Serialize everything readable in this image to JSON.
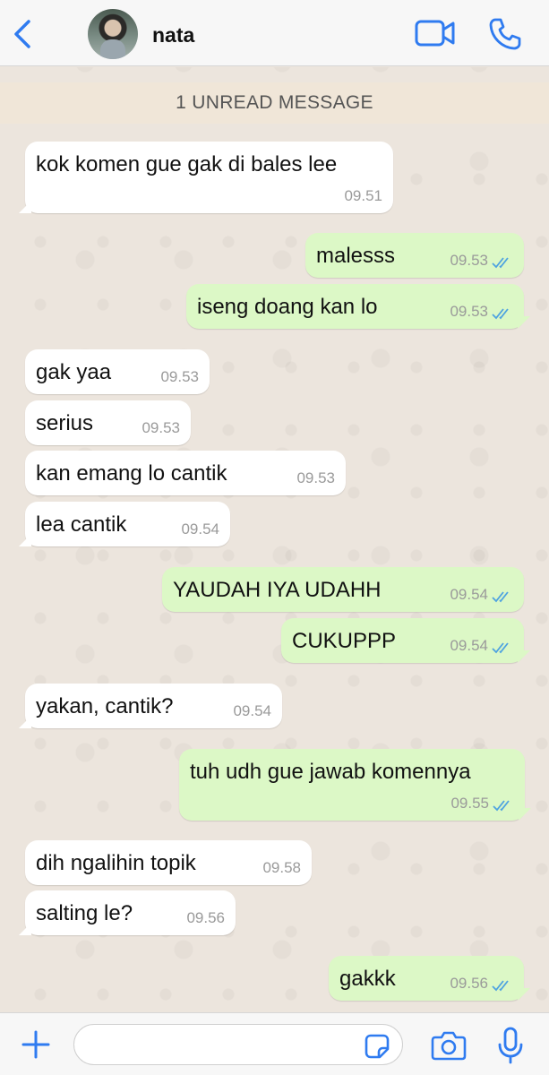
{
  "header": {
    "contact_name": "nata",
    "back_icon": "chevron-left-icon",
    "video_icon": "video-call-icon",
    "call_icon": "phone-icon",
    "accent_color": "#2f7bf0"
  },
  "chat": {
    "unread_banner": "1 UNREAD MESSAGE",
    "messages": [
      {
        "dir": "in",
        "text": "kok komen gue gak di bales lee",
        "time": "09.51"
      },
      {
        "dir": "out",
        "text": "malesss",
        "time": "09.53",
        "status": "read"
      },
      {
        "dir": "out",
        "text": "iseng doang kan lo",
        "time": "09.53",
        "status": "read"
      },
      {
        "dir": "in",
        "text": "gak yaa",
        "time": "09.53"
      },
      {
        "dir": "in",
        "text": "serius",
        "time": "09.53"
      },
      {
        "dir": "in",
        "text": "kan emang lo cantik",
        "time": "09.53"
      },
      {
        "dir": "in",
        "text": "lea cantik",
        "time": "09.54"
      },
      {
        "dir": "out",
        "text": "YAUDAH IYA UDAHH",
        "time": "09.54",
        "status": "read"
      },
      {
        "dir": "out",
        "text": "CUKUPPP",
        "time": "09.54",
        "status": "read"
      },
      {
        "dir": "in",
        "text": "yakan, cantik?",
        "time": "09.54"
      },
      {
        "dir": "out",
        "text": "tuh udh gue jawab komennya",
        "time": "09.55",
        "status": "read"
      },
      {
        "dir": "in",
        "text": "dih ngalihin topik",
        "time": "09.58"
      },
      {
        "dir": "in",
        "text": "salting le?",
        "time": "09.56"
      },
      {
        "dir": "out",
        "text": "gakkk",
        "time": "09.56",
        "status": "read"
      }
    ],
    "colors": {
      "incoming": "#ffffff",
      "outgoing": "#dcf8c6",
      "read_ticks": "#4fa3e0"
    }
  },
  "composer": {
    "input_value": "",
    "plus_icon": "plus-icon",
    "sticker_icon": "sticker-icon",
    "camera_icon": "camera-icon",
    "mic_icon": "microphone-icon"
  }
}
